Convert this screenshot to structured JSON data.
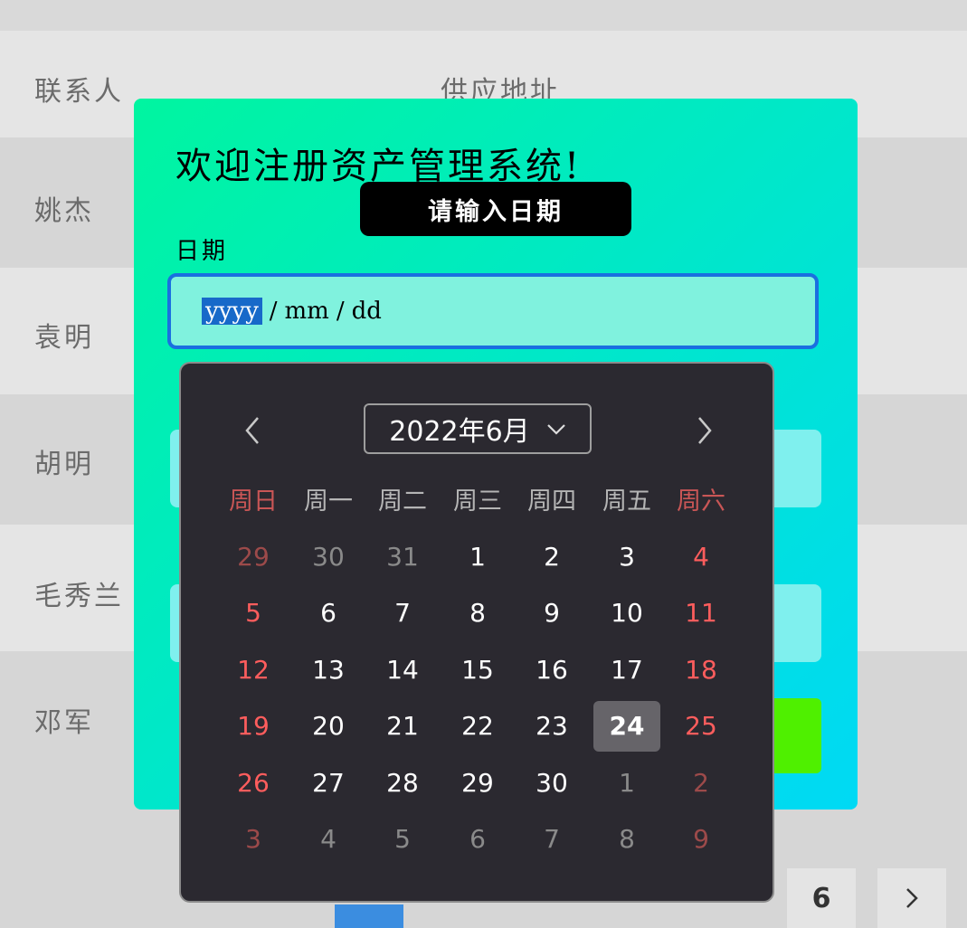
{
  "table": {
    "headers": {
      "contact": "联系人",
      "address": "供应地址"
    },
    "contacts": [
      "姚杰",
      "袁明",
      "胡明",
      "毛秀兰",
      "邓军"
    ]
  },
  "modal": {
    "title": "欢迎注册资产管理系统!",
    "tooltip": "请输入日期",
    "date_label": "日期",
    "date_input": {
      "year": "yyyy",
      "month": "mm",
      "day": "dd",
      "sep": "/"
    }
  },
  "calendar": {
    "month_label": "2022年6月",
    "weekdays": [
      "周日",
      "周一",
      "周二",
      "周三",
      "周四",
      "周五",
      "周六"
    ],
    "weeks": [
      [
        "29",
        "30",
        "31",
        "1",
        "2",
        "3",
        "4"
      ],
      [
        "5",
        "6",
        "7",
        "8",
        "9",
        "10",
        "11"
      ],
      [
        "12",
        "13",
        "14",
        "15",
        "16",
        "17",
        "18"
      ],
      [
        "19",
        "20",
        "21",
        "22",
        "23",
        "24",
        "25"
      ],
      [
        "26",
        "27",
        "28",
        "29",
        "30",
        "1",
        "2"
      ],
      [
        "3",
        "4",
        "5",
        "6",
        "7",
        "8",
        "9"
      ]
    ],
    "today": "24",
    "colors": {
      "weekend": "#ff5d5d",
      "today_bg": "#666469",
      "panel": "#2b2930"
    }
  },
  "pager": {
    "visible_page": "6",
    "next_icon": "chevron-right-icon"
  }
}
